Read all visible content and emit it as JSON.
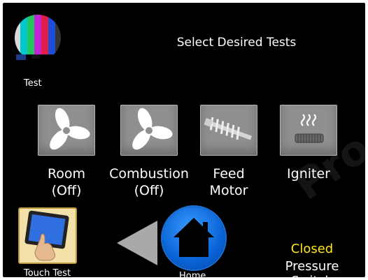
{
  "header": {
    "title": "Select Desired Tests",
    "test_label": "Test"
  },
  "tiles": [
    {
      "line1": "Room",
      "line2": "(Off)",
      "icon": "fan-icon"
    },
    {
      "line1": "Combustion",
      "line2": "(Off)",
      "icon": "fan-icon"
    },
    {
      "line1": "Feed",
      "line2": "Motor",
      "icon": "auger-icon"
    },
    {
      "line1": "Igniter",
      "line2": "",
      "icon": "igniter-icon"
    }
  ],
  "footer": {
    "touch_test_label": "Touch Test",
    "home_label": "Home",
    "pressure_switch_value": "Closed",
    "pressure_switch_label": "Pressure Switch"
  },
  "colors": {
    "background": "#000000",
    "status_value": "#ffe51a",
    "home_button": "#1673e6",
    "tile": "#8f8f8f"
  }
}
